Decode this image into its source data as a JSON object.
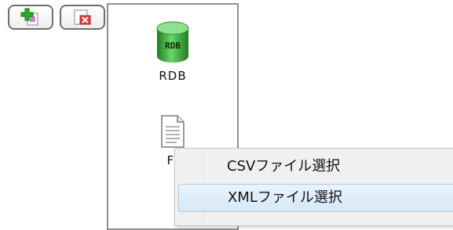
{
  "palette": {
    "items": [
      {
        "label": "RDB",
        "icon": "database-icon"
      },
      {
        "label": "FI",
        "icon": "file-icon"
      }
    ]
  },
  "toolbar": {
    "buttons": [
      {
        "icon": "add-icon"
      },
      {
        "icon": "delete-icon"
      }
    ]
  },
  "context_menu": {
    "items": [
      {
        "label": "CSVファイル選択"
      },
      {
        "label": "XMLファイル選択",
        "highlighted": true
      }
    ]
  },
  "colors": {
    "db_green": "#3aa53a",
    "menu_bg": "#f0f0f0",
    "highlight": "#d6e8f7"
  }
}
